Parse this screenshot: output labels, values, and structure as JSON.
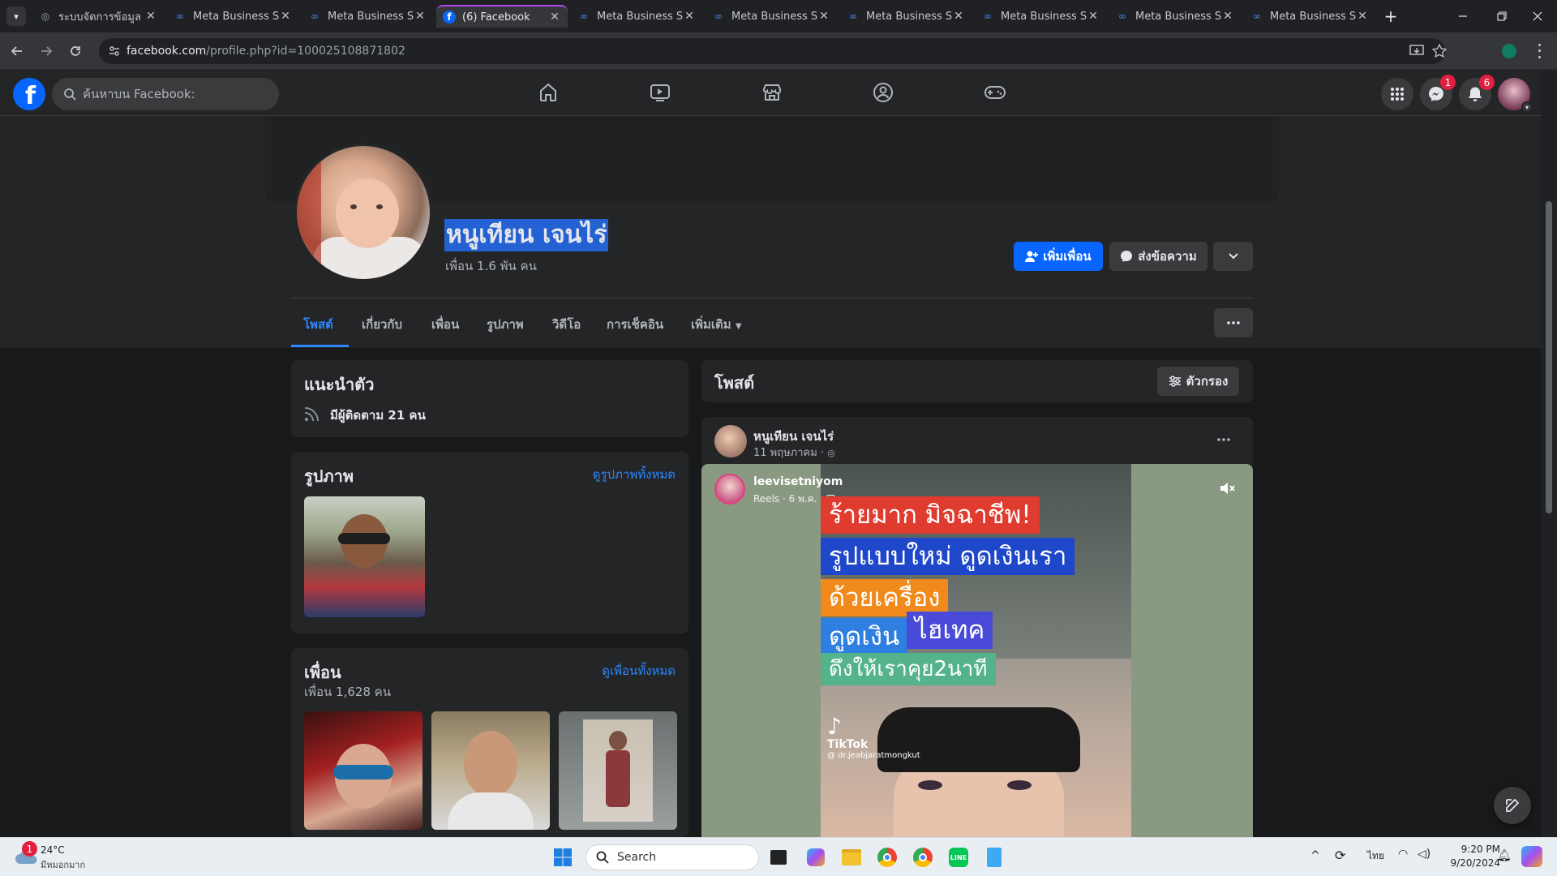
{
  "browser": {
    "tabs": [
      {
        "title": "ระบบจัดการข้อมูล ม่",
        "icon": "globe-icon",
        "active": false
      },
      {
        "title": "Meta Business Su",
        "icon": "meta-icon",
        "active": false
      },
      {
        "title": "Meta Business Su",
        "icon": "meta-icon",
        "active": false
      },
      {
        "title": "(6) Facebook",
        "icon": "facebook-icon",
        "active": true
      },
      {
        "title": "Meta Business Su",
        "icon": "meta-icon",
        "active": false
      },
      {
        "title": "Meta Business Su",
        "icon": "meta-icon",
        "active": false
      },
      {
        "title": "Meta Business Su",
        "icon": "meta-icon",
        "active": false
      },
      {
        "title": "Meta Business Su",
        "icon": "meta-icon",
        "active": false
      },
      {
        "title": "Meta Business Su",
        "icon": "meta-icon",
        "active": false
      },
      {
        "title": "Meta Business Su",
        "icon": "meta-icon",
        "active": false
      }
    ],
    "url_host": "facebook.com",
    "url_path": "/profile.php?id=100025108871802"
  },
  "fb": {
    "search_placeholder": "ค้นหาบน Facebook:",
    "messenger_badge": "1",
    "notifications_badge": "6"
  },
  "profile": {
    "name": "หนูเทียน เจนไร่",
    "friends_summary": "เพื่อน 1.6 พัน คน",
    "add_friend": "เพิ่มเพื่อน",
    "message": "ส่งข้อความ",
    "tabs": [
      "โพสต์",
      "เกี่ยวกับ",
      "เพื่อน",
      "รูปภาพ",
      "วิดีโอ",
      "การเช็คอิน",
      "เพิ่มเติม"
    ]
  },
  "intro": {
    "title": "แนะนำตัว",
    "followers": "มีผู้ติดตาม 21 คน"
  },
  "photos": {
    "title": "รูปภาพ",
    "see_all": "ดูรูปภาพทั้งหมด"
  },
  "friends": {
    "title": "เพื่อน",
    "count": "เพื่อน 1,628 คน",
    "see_all": "ดูเพื่อนทั้งหมด"
  },
  "posts": {
    "title": "โพสต์",
    "filter": "ตัวกรอง",
    "author": "หนูเทียน เจนไร่",
    "date": "11 พฤษภาคม ·",
    "reel_author": "leevisetniyom",
    "reel_meta": "Reels · 6 พ.ค. ·",
    "captions": [
      "ร้ายมาก มิจฉาชีพ!",
      "รูปแบบใหม่ ดูดเงินเรา",
      "ด้วยเครื่อง",
      "ดูดเงิน",
      "ไฮเทค",
      "ดึงให้เราคุย2นาที"
    ],
    "caption_colors": [
      "#e03b2f",
      "#1f47c9",
      "#f08a1c",
      "#2f7fe0",
      "#4a4ad8",
      "#54b38a"
    ],
    "tiktok_label": "TikTok",
    "tiktok_handle": "@ dr.jeabjaratmongkut"
  },
  "taskbar": {
    "temp": "24°C",
    "weather": "มีหมอกมาก",
    "weather_badge": "1",
    "search": "Search",
    "lang": "ไทย",
    "time": "9:20 PM",
    "date": "9/20/2024"
  }
}
